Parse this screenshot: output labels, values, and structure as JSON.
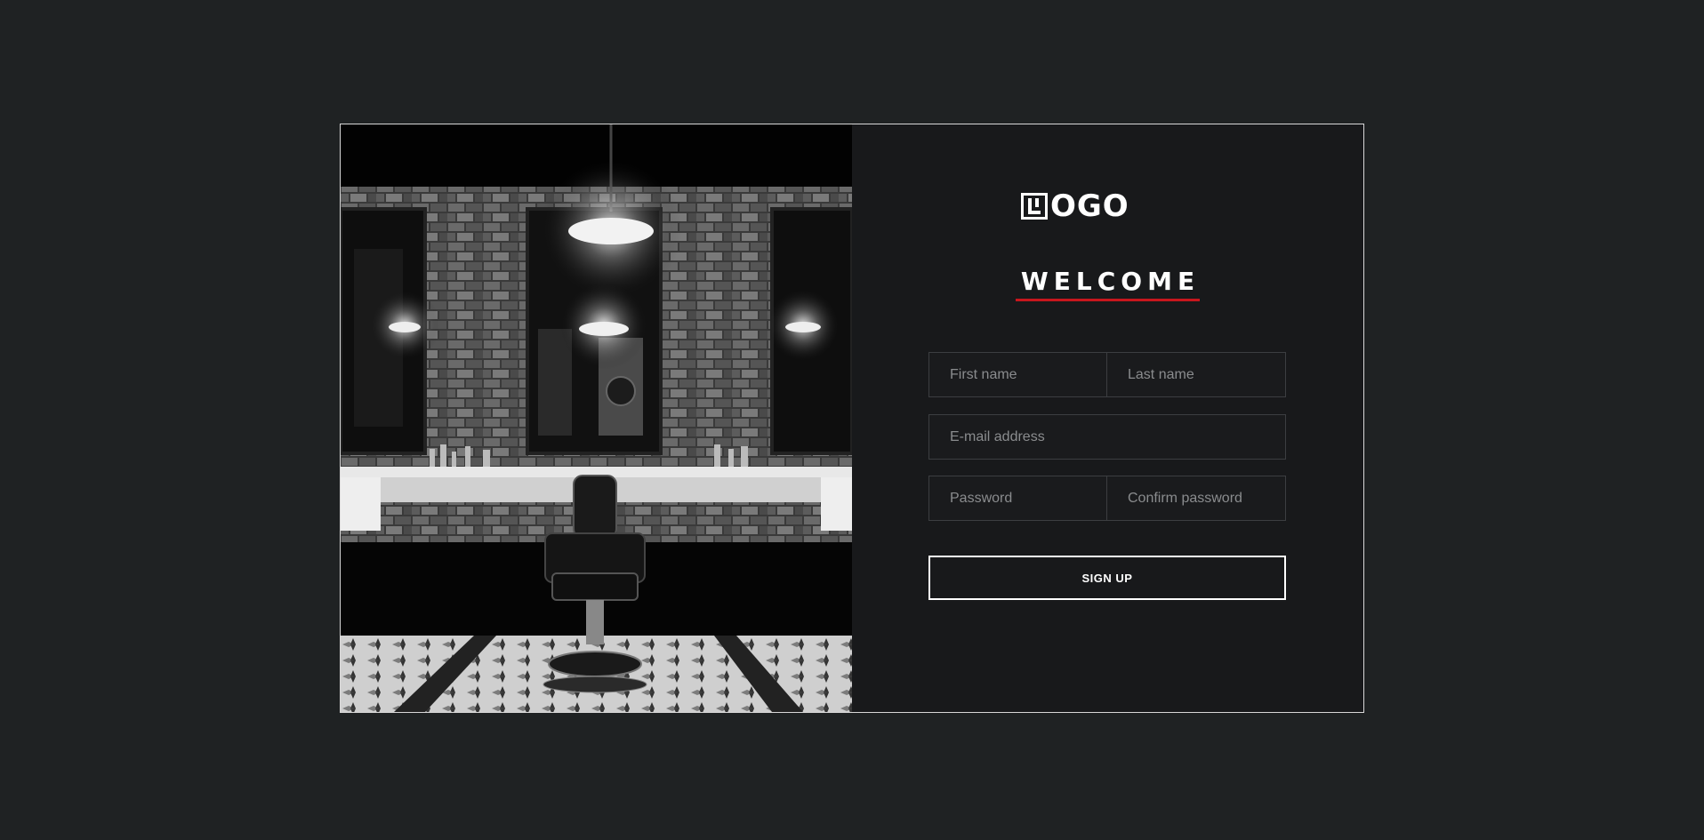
{
  "brand": {
    "logo_text": "OGO",
    "logo_mark_letter": "L"
  },
  "heading": {
    "welcome": "WELCOME"
  },
  "form": {
    "first_name_placeholder": "First name",
    "last_name_placeholder": "Last name",
    "email_placeholder": "E-mail address",
    "password_placeholder": "Password",
    "confirm_password_placeholder": "Confirm password",
    "submit_label": "SIGN UP"
  },
  "colors": {
    "page_bg": "#1f2223",
    "panel_bg": "#18191b",
    "accent": "#c8161d",
    "text": "#ffffff"
  }
}
